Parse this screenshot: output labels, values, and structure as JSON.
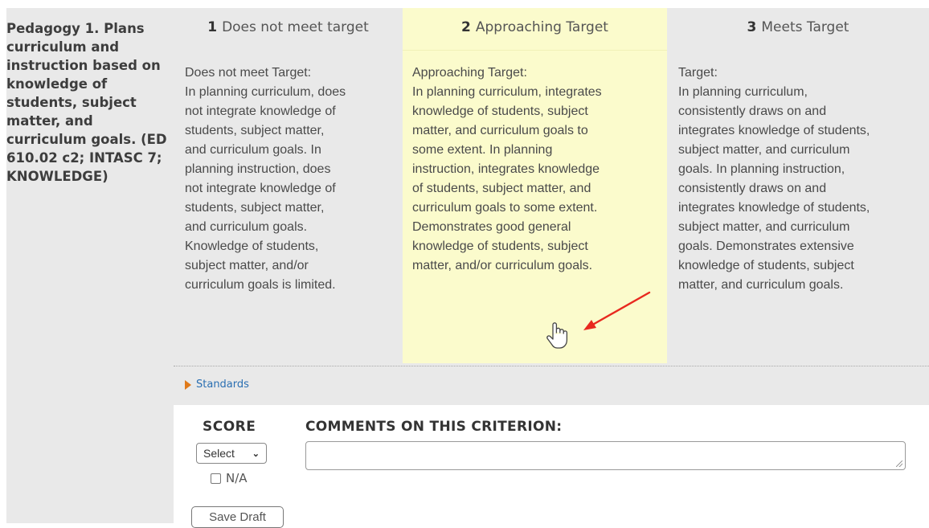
{
  "criterion": {
    "title": "Pedagogy 1. Plans curriculum and instruction based on knowledge of students, subject matter, and curriculum goals. (ED 610.02 c2; INTASC 7; KNOWLEDGE)"
  },
  "levels": [
    {
      "number": "1",
      "label": "Does not meet target",
      "description": "Does not meet Target:\nIn planning curriculum, does\nnot integrate knowledge of\nstudents, subject matter,\nand curriculum goals. In\nplanning instruction, does\nnot integrate knowledge of\nstudents, subject matter,\nand curriculum goals.\nKnowledge of students,\nsubject matter, and/or\ncurriculum goals is limited."
    },
    {
      "number": "2",
      "label": "Approaching Target",
      "description": "Approaching Target:\nIn planning curriculum, integrates\nknowledge of students, subject\nmatter, and curriculum goals to\nsome extent. In planning\ninstruction, integrates knowledge\nof students, subject matter, and\ncurriculum goals to some extent.\nDemonstrates good general\nknowledge of students, subject\nmatter, and/or curriculum goals."
    },
    {
      "number": "3",
      "label": "Meets Target",
      "description": "Target:\nIn planning curriculum,\nconsistently draws on and\nintegrates knowledge of students,\nsubject matter, and curriculum\ngoals. In planning instruction,\nconsistently draws on and\nintegrates knowledge of students,\nsubject matter, and curriculum\ngoals. Demonstrates extensive\nknowledge of students, subject\nmatter, and curriculum goals."
    }
  ],
  "standards": {
    "label": "Standards",
    "icon": "triangle-right-icon"
  },
  "score": {
    "label": "SCORE",
    "select_value": "Select",
    "na_label": "N/A",
    "save_label": "Save Draft"
  },
  "comments": {
    "label": "COMMENTS ON THIS CRITERION:",
    "value": ""
  },
  "colors": {
    "selected_bg": "#fbfbcc",
    "panel_bg": "#e9e9e9",
    "link": "#2a6fb2",
    "annotation_arrow": "#e8291f"
  }
}
